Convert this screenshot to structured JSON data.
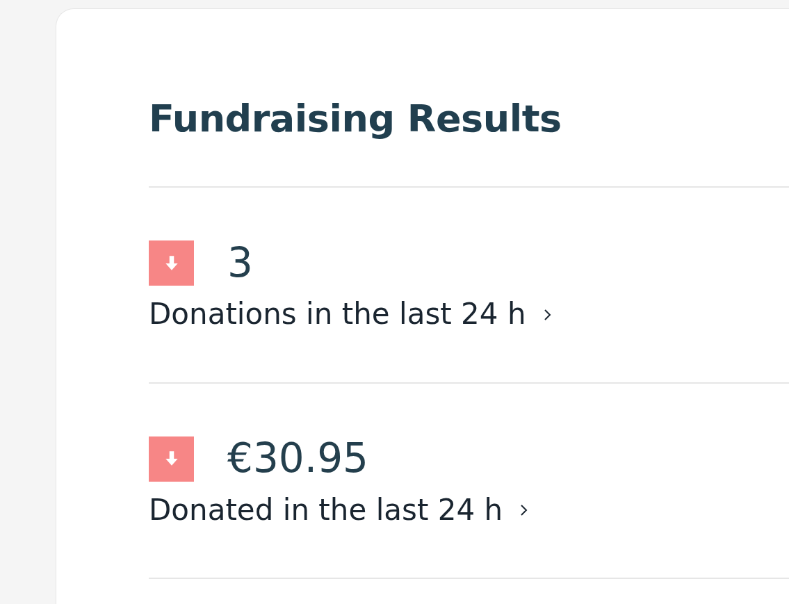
{
  "title": "Fundraising Results",
  "metrics": [
    {
      "kind": "decrease",
      "value": "3",
      "label": "Donations in the last 24 h"
    },
    {
      "kind": "decrease",
      "value": "€30.95",
      "label": "Donated in the last 24 h"
    }
  ]
}
